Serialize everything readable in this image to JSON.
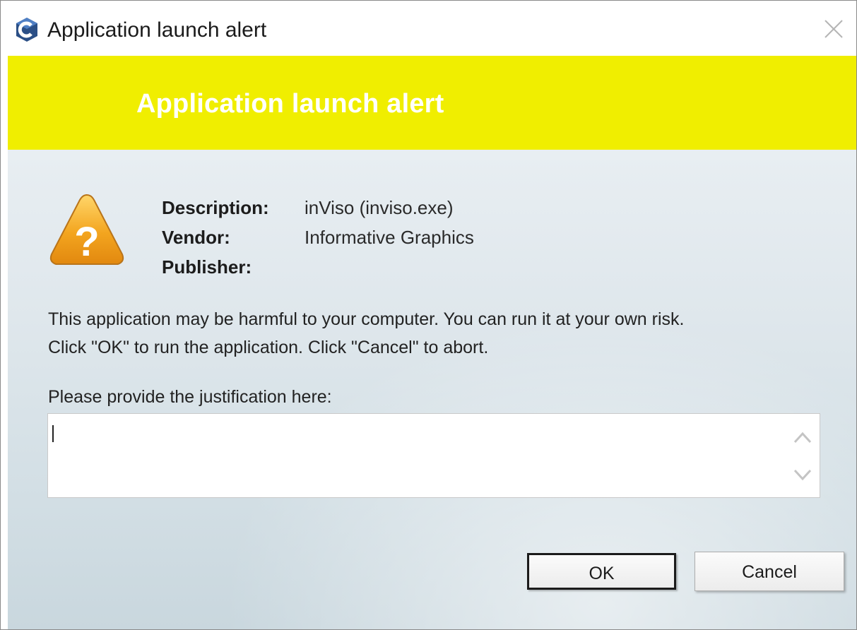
{
  "window": {
    "title": "Application launch alert"
  },
  "banner": {
    "heading": "Application launch alert",
    "color": "#f0ee00"
  },
  "info": {
    "description_label": "Description:",
    "description_value": "inViso (inviso.exe)",
    "vendor_label": "Vendor:",
    "vendor_value": "Informative Graphics",
    "publisher_label": "Publisher:",
    "publisher_value": ""
  },
  "message": {
    "line1": "This application may be harmful to your computer. You can run it at your own risk.",
    "line2": "Click \"OK\" to run the application. Click \"Cancel\" to abort."
  },
  "justification": {
    "label": "Please provide the justification here:",
    "value": ""
  },
  "buttons": {
    "ok_label": "OK",
    "cancel_label": "Cancel"
  },
  "icons": {
    "app": "app-logo-icon",
    "close": "close-icon",
    "warning": "warning-question-icon",
    "scroll_up": "chevron-up-icon",
    "scroll_down": "chevron-down-icon"
  }
}
